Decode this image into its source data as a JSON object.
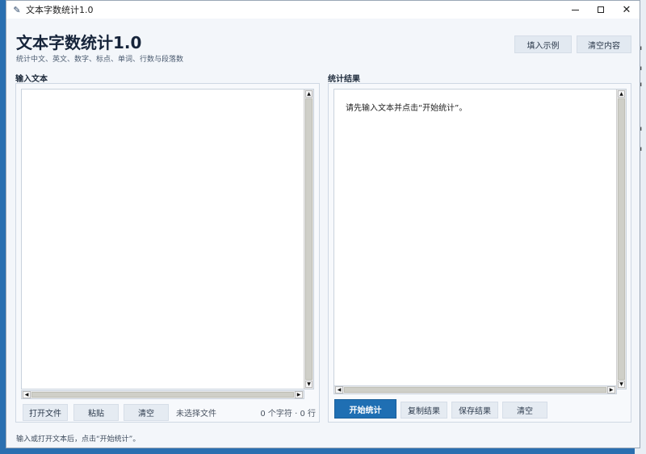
{
  "window": {
    "title": "文本字数统计1.0"
  },
  "header": {
    "title": "文本字数统计1.0",
    "subtitle": "统计中文、英文、数字、标点、单词、行数与段落数",
    "fill_example_label": "填入示例",
    "clear_content_label": "清空内容"
  },
  "input_panel": {
    "label": "输入文本",
    "text_value": "",
    "open_file_label": "打开文件",
    "paste_label": "粘贴",
    "clear_label": "清空",
    "file_status": "未选择文件",
    "counts": "0 个字符 · 0 行"
  },
  "result_panel": {
    "label": "统计结果",
    "text": "请先输入文本并点击“开始统计”。",
    "start_label": "开始统计",
    "copy_label": "复制结果",
    "save_label": "保存结果",
    "clear_label": "清空"
  },
  "status_bar": {
    "text": "输入或打开文本后，点击“开始统计”。"
  },
  "colors": {
    "accent": "#1f6fb3",
    "background": "#f3f6fa",
    "title": "#16243a"
  }
}
